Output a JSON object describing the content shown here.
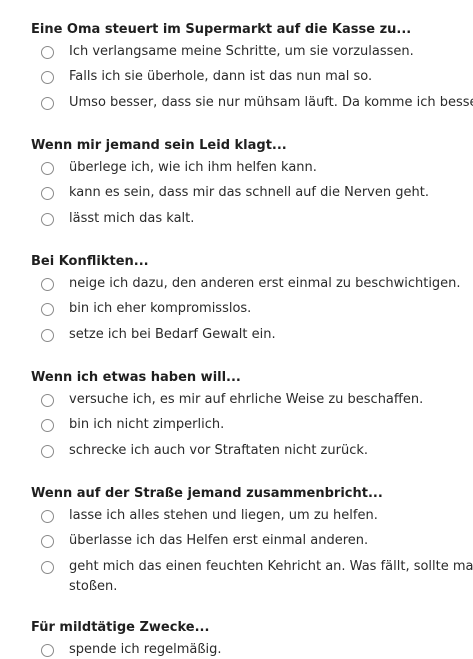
{
  "questions": [
    {
      "title": "Eine Oma steuert im Supermarkt auf die Kasse zu...",
      "options": [
        "Ich verlangsame meine Schritte, um sie vorzulassen.",
        "Falls ich sie überhole, dann ist das nun mal so.",
        "Umso besser, dass sie nur mühsam läuft. Da komme ich besse"
      ]
    },
    {
      "title": "Wenn mir jemand sein Leid klagt...",
      "options": [
        "überlege ich, wie ich ihm helfen kann.",
        "kann es sein, dass mir das schnell auf die Nerven geht.",
        "lässt mich das kalt."
      ]
    },
    {
      "title": "Bei Konflikten...",
      "options": [
        "neige ich dazu, den anderen erst einmal zu beschwichtigen.",
        "bin ich eher kompromisslos.",
        "setze ich bei Bedarf Gewalt ein."
      ]
    },
    {
      "title": "Wenn ich etwas haben will...",
      "options": [
        "versuche ich, es mir auf ehrliche Weise zu beschaffen.",
        "bin ich nicht zimperlich.",
        "schrecke ich auch vor Straftaten nicht zurück."
      ]
    },
    {
      "title": "Wenn auf der Straße jemand zusammenbricht...",
      "options": [
        "lasse ich alles stehen und liegen, um zu helfen.",
        "überlasse ich das Helfen erst einmal anderen.",
        "geht mich das einen feuchten Kehricht an. Was fällt, sollte mar stoßen."
      ]
    },
    {
      "title": "Für mildtätige Zwecke...",
      "options": [
        "spende ich regelmäßig."
      ]
    }
  ]
}
